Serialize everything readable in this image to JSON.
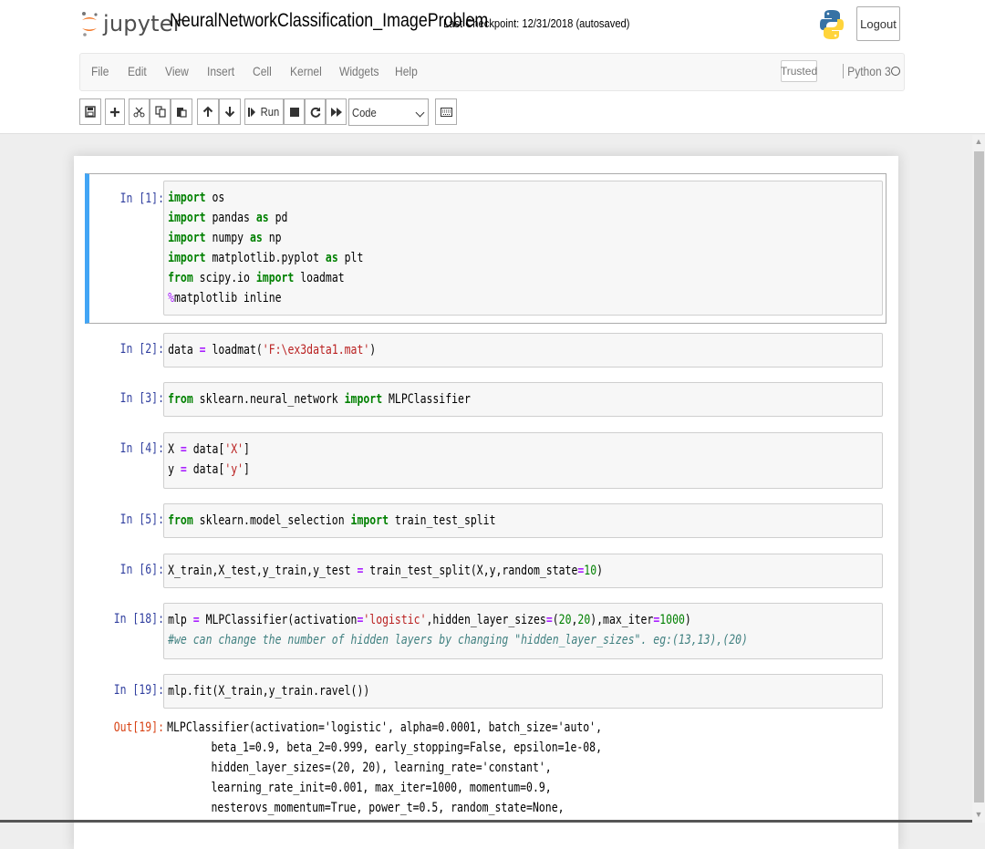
{
  "header": {
    "logo_text": "jupyter",
    "notebook_title": "NeuralNetworkClassification_ImageProblem",
    "checkpoint_text": "Last Checkpoint: 12/31/2018  (autosaved)",
    "logout_label": "Logout"
  },
  "menu": {
    "items": [
      "File",
      "Edit",
      "View",
      "Insert",
      "Cell",
      "Kernel",
      "Widgets",
      "Help"
    ],
    "trusted_label": "Trusted",
    "kernel_name": "Python 3"
  },
  "toolbar": {
    "run_label": "Run",
    "cell_type": "Code"
  },
  "cells": [
    {
      "prompt": "In [1]:",
      "code": "import os\nimport pandas as pd\nimport numpy as np\nimport matplotlib.pyplot as plt\nfrom scipy.io import loadmat\n%matplotlib inline"
    },
    {
      "prompt": "In [2]:",
      "code": "data = loadmat('F:\\ex3data1.mat')"
    },
    {
      "prompt": "In [3]:",
      "code": "from sklearn.neural_network import MLPClassifier"
    },
    {
      "prompt": "In [4]:",
      "code": "X = data['X']\ny = data['y']"
    },
    {
      "prompt": "In [5]:",
      "code": "from sklearn.model_selection import train_test_split"
    },
    {
      "prompt": "In [6]:",
      "code": "X_train,X_test,y_train,y_test = train_test_split(X,y,random_state=10)"
    },
    {
      "prompt": "In [18]:",
      "code": "mlp = MLPClassifier(activation='logistic',hidden_layer_sizes=(20,20),max_iter=1000)\n#we can change the number of hidden layers by changing \"hidden_layer_sizes\". eg:(13,13),(20)"
    },
    {
      "prompt": "In [19]:",
      "code": "mlp.fit(X_train,y_train.ravel())"
    }
  ],
  "output": {
    "prompt": "Out[19]:",
    "text": "MLPClassifier(activation='logistic', alpha=0.0001, batch_size='auto',\n       beta_1=0.9, beta_2=0.999, early_stopping=False, epsilon=1e-08,\n       hidden_layer_sizes=(20, 20), learning_rate='constant',\n       learning_rate_init=0.001, max_iter=1000, momentum=0.9,\n       nesterovs_momentum=True, power_t=0.5, random_state=None,"
  }
}
